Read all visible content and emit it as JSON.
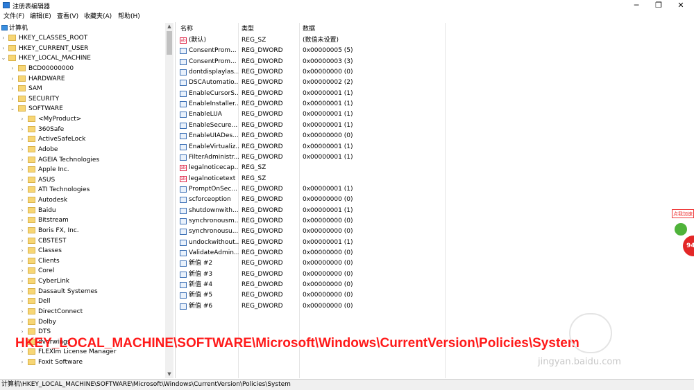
{
  "window": {
    "title": "注册表编辑器",
    "controls": [
      "─",
      "❐",
      "✕"
    ]
  },
  "menu": [
    "文件(F)",
    "编辑(E)",
    "查看(V)",
    "收藏夹(A)",
    "帮助(H)"
  ],
  "tree": {
    "root": "计算机",
    "hives": [
      "HKEY_CLASSES_ROOT",
      "HKEY_CURRENT_USER",
      "HKEY_LOCAL_MACHINE"
    ],
    "hklm_children": [
      "BCD00000000",
      "HARDWARE",
      "SAM",
      "SECURITY",
      "SOFTWARE"
    ],
    "software_children": [
      "<MyProduct>",
      "360Safe",
      "ActiveSafeLock",
      "Adobe",
      "AGEIA Technologies",
      "Apple Inc.",
      "ASUS",
      "ATI Technologies",
      "Autodesk",
      "Baidu",
      "Bitstream",
      "Boris FX, Inc.",
      "CBSTEST",
      "Classes",
      "Clients",
      "Corel",
      "CyberLink",
      "Dassault Systemes",
      "Dell",
      "DirectConnect",
      "Dolby",
      "DTS",
      "dvdrwings",
      "FLEXlm License Manager",
      "Foxit Software"
    ]
  },
  "columns": {
    "name": "名称",
    "type": "类型",
    "data": "数据"
  },
  "values": [
    {
      "name": "(默认)",
      "type": "REG_SZ",
      "data": "(数值未设置)",
      "icon": "string"
    },
    {
      "name": "ConsentProm...",
      "type": "REG_DWORD",
      "data": "0x00000005 (5)",
      "icon": "dword"
    },
    {
      "name": "ConsentProm...",
      "type": "REG_DWORD",
      "data": "0x00000003 (3)",
      "icon": "dword"
    },
    {
      "name": "dontdisplaylas...",
      "type": "REG_DWORD",
      "data": "0x00000000 (0)",
      "icon": "dword"
    },
    {
      "name": "DSCAutomatio...",
      "type": "REG_DWORD",
      "data": "0x00000002 (2)",
      "icon": "dword"
    },
    {
      "name": "EnableCursorS...",
      "type": "REG_DWORD",
      "data": "0x00000001 (1)",
      "icon": "dword"
    },
    {
      "name": "EnableInstaller...",
      "type": "REG_DWORD",
      "data": "0x00000001 (1)",
      "icon": "dword"
    },
    {
      "name": "EnableLUA",
      "type": "REG_DWORD",
      "data": "0x00000001 (1)",
      "icon": "dword"
    },
    {
      "name": "EnableSecure...",
      "type": "REG_DWORD",
      "data": "0x00000001 (1)",
      "icon": "dword"
    },
    {
      "name": "EnableUIADes...",
      "type": "REG_DWORD",
      "data": "0x00000000 (0)",
      "icon": "dword"
    },
    {
      "name": "EnableVirtualiz...",
      "type": "REG_DWORD",
      "data": "0x00000001 (1)",
      "icon": "dword"
    },
    {
      "name": "FilterAdministr...",
      "type": "REG_DWORD",
      "data": "0x00000001 (1)",
      "icon": "dword"
    },
    {
      "name": "legalnoticecap...",
      "type": "REG_SZ",
      "data": "",
      "icon": "string"
    },
    {
      "name": "legalnoticetext",
      "type": "REG_SZ",
      "data": "",
      "icon": "string"
    },
    {
      "name": "PromptOnSec...",
      "type": "REG_DWORD",
      "data": "0x00000001 (1)",
      "icon": "dword"
    },
    {
      "name": "scforceoption",
      "type": "REG_DWORD",
      "data": "0x00000000 (0)",
      "icon": "dword"
    },
    {
      "name": "shutdownwith...",
      "type": "REG_DWORD",
      "data": "0x00000001 (1)",
      "icon": "dword"
    },
    {
      "name": "synchronousm...",
      "type": "REG_DWORD",
      "data": "0x00000000 (0)",
      "icon": "dword"
    },
    {
      "name": "synchronousu...",
      "type": "REG_DWORD",
      "data": "0x00000000 (0)",
      "icon": "dword"
    },
    {
      "name": "undockwithout...",
      "type": "REG_DWORD",
      "data": "0x00000001 (1)",
      "icon": "dword"
    },
    {
      "name": "ValidateAdmin...",
      "type": "REG_DWORD",
      "data": "0x00000000 (0)",
      "icon": "dword"
    },
    {
      "name": "新值 #2",
      "type": "REG_DWORD",
      "data": "0x00000000 (0)",
      "icon": "dword"
    },
    {
      "name": "新值 #3",
      "type": "REG_DWORD",
      "data": "0x00000000 (0)",
      "icon": "dword"
    },
    {
      "name": "新值 #4",
      "type": "REG_DWORD",
      "data": "0x00000000 (0)",
      "icon": "dword"
    },
    {
      "name": "新值 #5",
      "type": "REG_DWORD",
      "data": "0x00000000 (0)",
      "icon": "dword"
    },
    {
      "name": "新值 #6",
      "type": "REG_DWORD",
      "data": "0x00000000 (0)",
      "icon": "dword"
    }
  ],
  "status_path": "计算机\\HKEY_LOCAL_MACHINE\\SOFTWARE\\Microsoft\\Windows\\CurrentVersion\\Policies\\System",
  "overlay_caption": "HKEY_LOCAL_MACHINE\\SOFTWARE\\Microsoft\\Windows\\CurrentVersion\\Policies\\System",
  "widget": {
    "tag": "点我加速",
    "number": "94"
  },
  "watermark": "jingyan.baidu.com"
}
